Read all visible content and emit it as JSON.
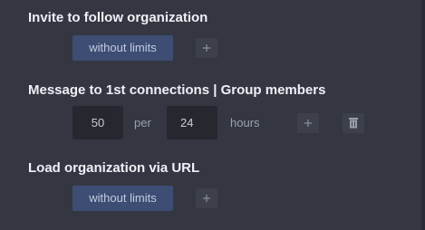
{
  "sections": {
    "invite": {
      "title": "Invite to follow organization",
      "limit_label": "without limits"
    },
    "message": {
      "title": "Message to 1st connections | Group members",
      "count_value": "50",
      "per_label": "per",
      "period_value": "24",
      "unit_label": "hours"
    },
    "load": {
      "title": "Load organization via URL",
      "limit_label": "without limits"
    }
  },
  "icons": {
    "add": "plus-icon",
    "delete": "trash-icon"
  },
  "colors": {
    "background": "#343742",
    "pill_background": "#3d4d73",
    "pill_text": "#c3cbe0",
    "input_background": "#262830",
    "button_background": "#3d404b",
    "title_text": "#eef0f5",
    "muted_text": "#9da1ae"
  }
}
